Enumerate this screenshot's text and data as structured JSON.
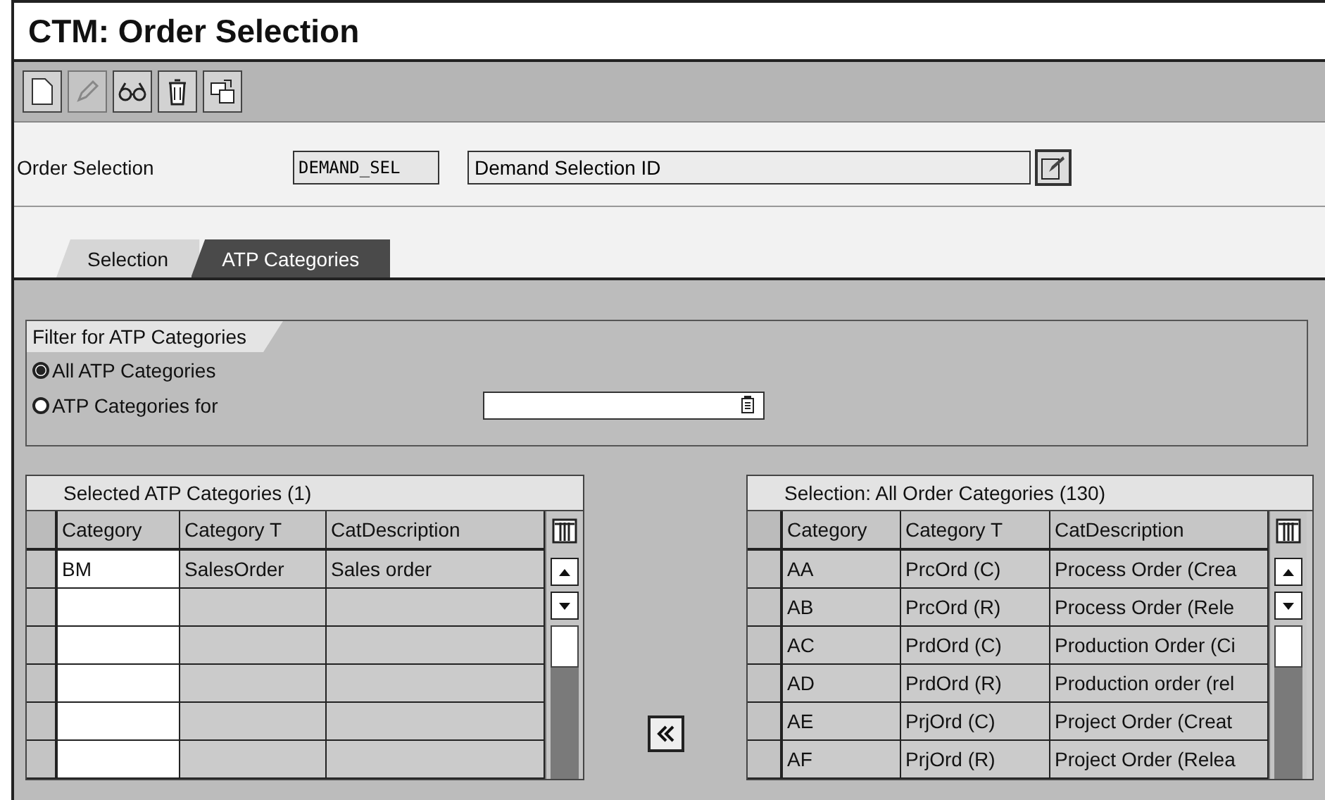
{
  "window": {
    "title": "CTM: Order Selection"
  },
  "toolbar": {
    "buttons": [
      {
        "kind": "new",
        "disabled": false
      },
      {
        "kind": "edit",
        "disabled": true
      },
      {
        "kind": "display",
        "disabled": false
      },
      {
        "kind": "delete",
        "disabled": false
      },
      {
        "kind": "copy",
        "disabled": false
      }
    ]
  },
  "header": {
    "label": "Order Selection",
    "id_value": "DEMAND_SEL",
    "description_value": "Demand Selection ID"
  },
  "tabs": [
    {
      "label": "Selection",
      "selected": false
    },
    {
      "label": "ATP Categories",
      "selected": true
    }
  ],
  "filter": {
    "title": "Filter for ATP Categories",
    "options": [
      {
        "label": "All ATP Categories",
        "selected": true,
        "kind": "plain"
      },
      {
        "label": "ATP Categories for",
        "selected": false,
        "kind": "with_field"
      }
    ]
  },
  "selected_table": {
    "title": "Selected ATP Categories (1)",
    "columns": [
      "Category",
      "Category T",
      "CatDescription"
    ],
    "rows": [
      [
        "BM",
        "SalesOrder",
        "Sales order"
      ]
    ]
  },
  "all_table": {
    "title": "Selection: All Order Categories (130)",
    "columns": [
      "Category",
      "Category T",
      "CatDescription"
    ],
    "rows": [
      [
        "AA",
        "PrcOrd (C)",
        "Process Order (Crea"
      ],
      [
        "AB",
        "PrcOrd (R)",
        "Process Order (Rele"
      ],
      [
        "AC",
        "PrdOrd (C)",
        "Production Order (Ci"
      ],
      [
        "AD",
        "PrdOrd (R)",
        "Production order (rel"
      ],
      [
        "AE",
        "PrjOrd (C)",
        "Project Order (Creat"
      ],
      [
        "AF",
        "PrjOrd (R)",
        "Project Order (Relea"
      ]
    ]
  }
}
